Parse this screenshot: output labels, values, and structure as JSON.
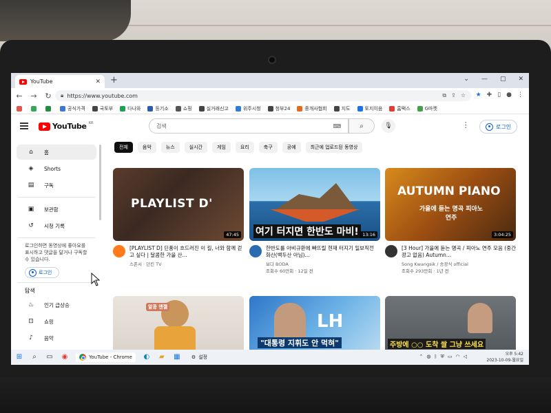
{
  "browser": {
    "tab_title": "YouTube",
    "new_tab": "+",
    "url": "https://www.youtube.com",
    "bookmarks": [
      {
        "label": "",
        "color": "#e2574c"
      },
      {
        "label": "",
        "color": "#34a853"
      },
      {
        "label": "",
        "color": "#1e8e3e"
      },
      {
        "label": "공식가격",
        "color": "#3c78d8"
      },
      {
        "label": "국토부",
        "color": "#444444"
      },
      {
        "label": "다나와",
        "color": "#19a34a"
      },
      {
        "label": "등기소",
        "color": "#2e5aac"
      },
      {
        "label": "쇼핑",
        "color": "#555555"
      },
      {
        "label": "실거래신고",
        "color": "#444444"
      },
      {
        "label": "위주시청",
        "color": "#2e7dd1"
      },
      {
        "label": "청부24",
        "color": "#444444"
      },
      {
        "label": "중개사협회",
        "color": "#e06c1c"
      },
      {
        "label": "지도",
        "color": "#444444"
      },
      {
        "label": "토지이음",
        "color": "#1a73e8"
      },
      {
        "label": "홈택스",
        "color": "#e53935"
      },
      {
        "label": "G마켓",
        "color": "#43a047"
      }
    ]
  },
  "masthead": {
    "logo": "YouTube",
    "logo_region": "KR",
    "search_placeholder": "검색",
    "login": "로그인"
  },
  "sidebar": {
    "items": [
      {
        "label": "홈",
        "icon": "home-icon",
        "glyph": "⌂"
      },
      {
        "label": "Shorts",
        "icon": "shorts-icon",
        "glyph": "◈"
      },
      {
        "label": "구독",
        "icon": "subscriptions-icon",
        "glyph": "▤"
      }
    ],
    "items2": [
      {
        "label": "보관함",
        "icon": "library-icon",
        "glyph": "▣"
      },
      {
        "label": "시청 기록",
        "icon": "history-icon",
        "glyph": "↺"
      }
    ],
    "note": "로그인하면 동영상에 좋아요를 표시하고 댓글을 달거나 구독할 수 있습니다.",
    "login": "로그인",
    "explore_title": "탐색",
    "explore": [
      {
        "label": "인기 급상승",
        "icon": "trending-icon",
        "glyph": "♨"
      },
      {
        "label": "쇼핑",
        "icon": "shopping-icon",
        "glyph": "⊡"
      },
      {
        "label": "음악",
        "icon": "music-icon",
        "glyph": "♪"
      }
    ]
  },
  "chips": [
    "전체",
    "음악",
    "뉴스",
    "실시간",
    "게임",
    "요리",
    "축구",
    "공예",
    "최근에 업로드된 동영상"
  ],
  "videos": [
    {
      "thumb_text": "PLAYLIST D'",
      "duration": "47:45",
      "title": "[PLAYLIST D] 딘풍이 흐드러진 이 길, 너와 함께 걷고 싶다 | 달콤한 가을 산...",
      "channel": "스폰서 · 던킨 TV",
      "stats": "",
      "avatar_color": "#ff7a1a"
    },
    {
      "thumb_text": "여기 터지면 한반도 마비!",
      "duration": "13:16",
      "title": "한반도를 아비규환에 빠뜨릴 현재 터지기 일보직전 화산(백두산 아님)...",
      "channel": "보다 BODA",
      "stats": "조회수 60만회 · 12일 전",
      "avatar_color": "#2b6cb0"
    },
    {
      "thumb_text": "AUTUMN PIANO",
      "thumb_sub": "가을에 듣는 명곡 피아노 연주",
      "duration": "3:04:25",
      "title": "[3 Hour] 가을에 듣는 명곡 / 피아노 연주 모음 (중간광고 없음) Autumn...",
      "channel": "Song Kwangsik / 송광식 official",
      "stats": "조회수 293만회 · 1년 전",
      "avatar_color": "#333333"
    },
    {
      "thumb_text": "알콩 엔젤",
      "duration": "",
      "title": "",
      "channel": "",
      "stats": "",
      "avatar_color": "#cccccc"
    },
    {
      "thumb_text": "\"대통령 지휘도 안 먹혀\"",
      "duration": "",
      "title": "",
      "channel": "",
      "stats": "",
      "avatar_color": "#cccccc"
    },
    {
      "thumb_text": "주방에 ○○ 도착 쌀 그냥 쓰세요",
      "duration": "",
      "title": "",
      "channel": "",
      "stats": "",
      "avatar_color": "#cccccc"
    }
  ],
  "taskbar": {
    "chrome_label": "YouTube - Chrome",
    "settings_label": "설정",
    "time": "오후 5:42",
    "date": "2023-10-09-월요일"
  }
}
